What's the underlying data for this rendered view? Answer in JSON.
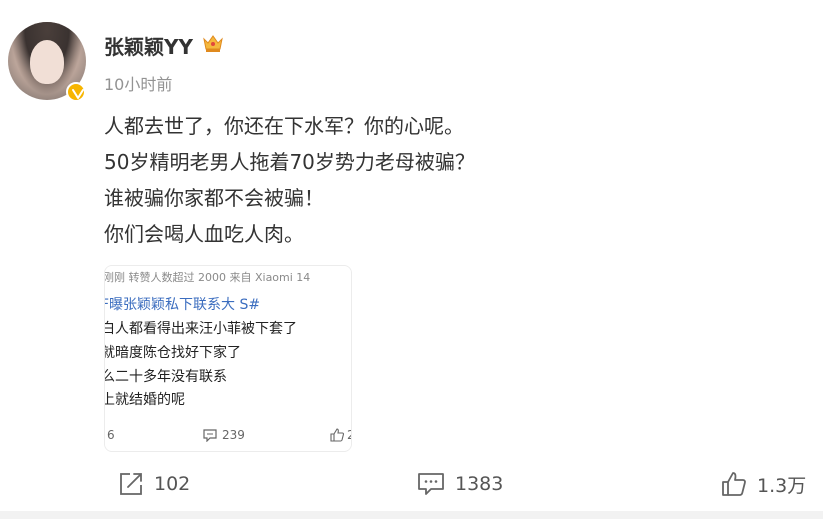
{
  "user": {
    "name": "张颖颖YY",
    "time": "10小时前"
  },
  "post": {
    "lines": [
      "人都去世了，你还在下水军？你的心呢。",
      "50岁精明老男人拖着70岁势力老母被骗？",
      "谁被骗你家都不会被骗！",
      "你们会喝人血吃人肉。"
    ]
  },
  "thumbnail": {
    "meta": "刚刚 转赞人数超过 2000  来自 Xiaomi 14",
    "link": "F曝张颖颖私下联系大 S#",
    "lines": [
      "白人都看得出来汪小菲被下套了",
      "就暗度陈仓找好下家了",
      "么二十多年没有联系",
      "上就结婚的呢"
    ],
    "footer_left": "6",
    "footer_comments": "239",
    "footer_like_partial": "2"
  },
  "actions": {
    "repost": "102",
    "comment": "1383",
    "like": "1.3万"
  },
  "colors": {
    "badge": "#f7b500",
    "link": "#3b6dbf"
  }
}
